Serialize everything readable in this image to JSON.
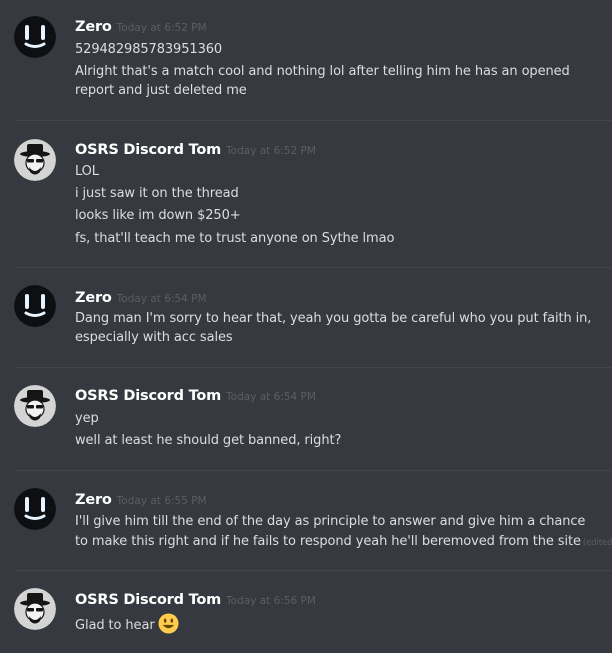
{
  "colors": {
    "background": "#36393f",
    "divider": "#42454a",
    "username": "#ffffff",
    "message_text": "#dcddde",
    "timestamp": "#5c5e64"
  },
  "messages": [
    {
      "author": "Zero",
      "avatar_icon": "zero-avatar-icon",
      "timestamp": "Today at 6:52 PM",
      "lines": [
        "529482985783951360",
        "Alright that's a match cool and nothing lol after telling him he has an opened",
        "report and just deleted me"
      ]
    },
    {
      "author": "OSRS Discord Tom",
      "avatar_icon": "heisenberg-avatar-icon",
      "timestamp": "Today at 6:52 PM",
      "lines": [
        "LOL",
        "i just saw it on the thread",
        "looks like im down $250+",
        "fs, that'll teach me to trust anyone on Sythe lmao"
      ]
    },
    {
      "author": "Zero",
      "avatar_icon": "zero-avatar-icon",
      "timestamp": "Today at 6:54 PM",
      "lines": [
        "Dang man I'm sorry to hear that, yeah you gotta be careful who you put faith in,",
        "especially with acc sales"
      ]
    },
    {
      "author": "OSRS Discord Tom",
      "avatar_icon": "heisenberg-avatar-icon",
      "timestamp": "Today at 6:54 PM",
      "lines": [
        "yep",
        "well at least he should get banned, right?"
      ]
    },
    {
      "author": "Zero",
      "avatar_icon": "zero-avatar-icon",
      "timestamp": "Today at 6:55 PM",
      "lines": [
        "I'll give him till the end of the day as principle to answer and give him a chance",
        "to make this right and if he fails to respond yeah he'll beremoved from the site"
      ],
      "edited_label": "(edited)"
    },
    {
      "author": "OSRS Discord Tom",
      "avatar_icon": "heisenberg-avatar-icon",
      "timestamp": "Today at 6:56 PM",
      "lines": [
        "Glad to hear"
      ],
      "emoji_icon": "smiley-emoji-icon"
    }
  ]
}
